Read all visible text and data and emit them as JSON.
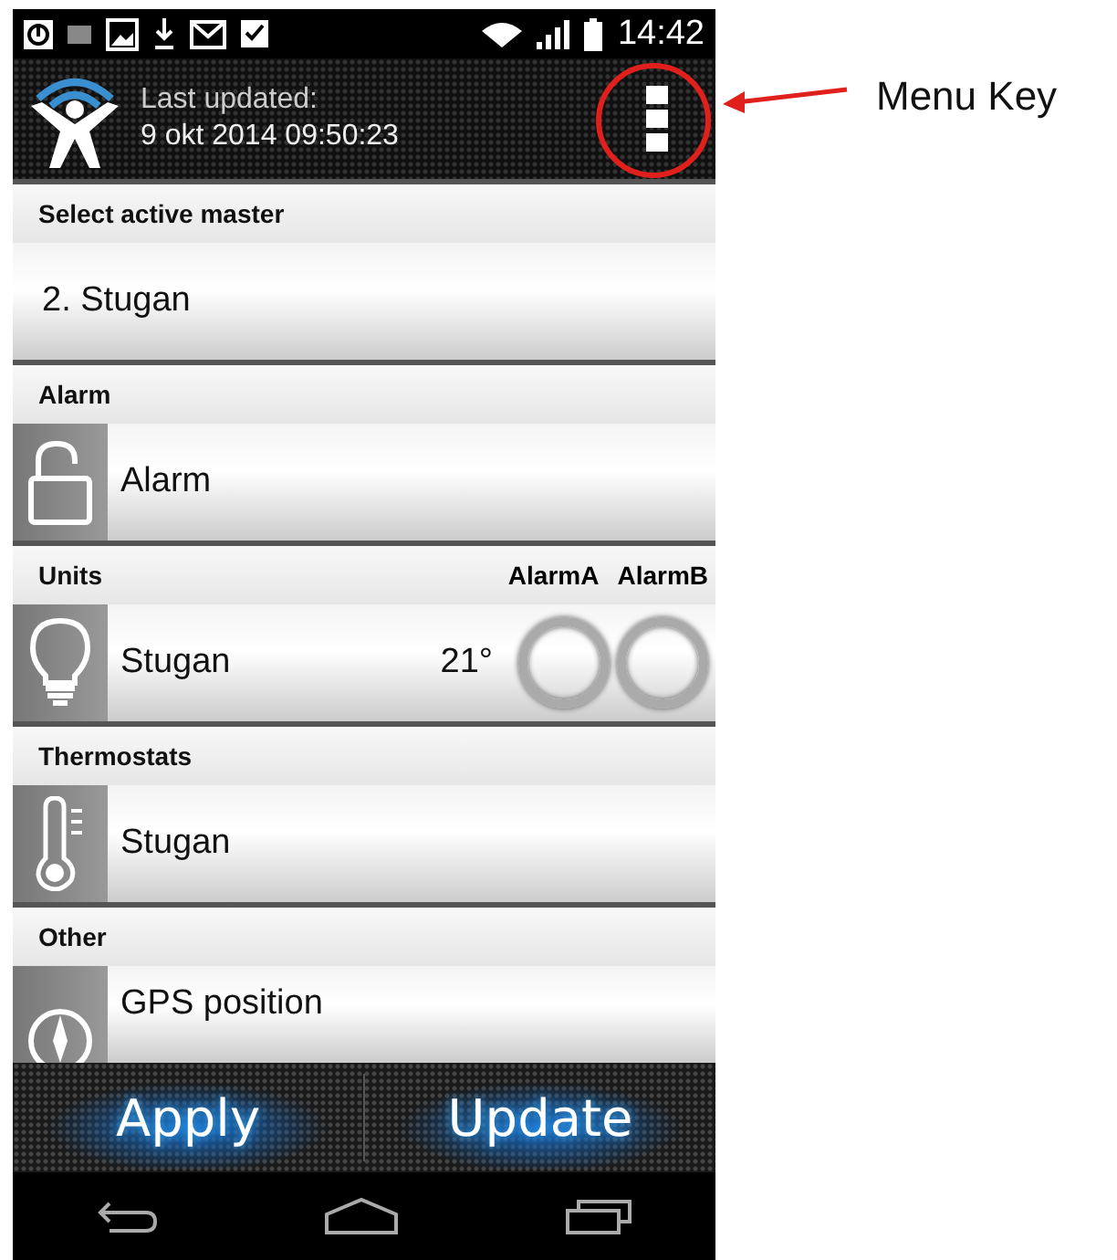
{
  "status_bar": {
    "time": "14:42"
  },
  "header": {
    "line_1": "Last updated:",
    "line_2": "9 okt 2014 09:50:23"
  },
  "sections": [
    {
      "title": "Select active master",
      "rows": [
        {
          "kind": "master",
          "label": "2. Stugan"
        }
      ]
    },
    {
      "title": "Alarm",
      "rows": [
        {
          "kind": "alarm",
          "label": "Alarm"
        }
      ]
    },
    {
      "title": "Units",
      "columns": [
        "AlarmA",
        "AlarmB"
      ],
      "rows": [
        {
          "kind": "unit",
          "label": "Stugan",
          "value": "21°"
        }
      ]
    },
    {
      "title": "Thermostats",
      "rows": [
        {
          "kind": "thermostat",
          "label": "Stugan"
        }
      ]
    },
    {
      "title": "Other",
      "rows": [
        {
          "kind": "gps",
          "label": "GPS position"
        }
      ]
    }
  ],
  "buttons": [
    "Apply",
    "Update"
  ],
  "annotation": {
    "label": "Menu Key"
  }
}
